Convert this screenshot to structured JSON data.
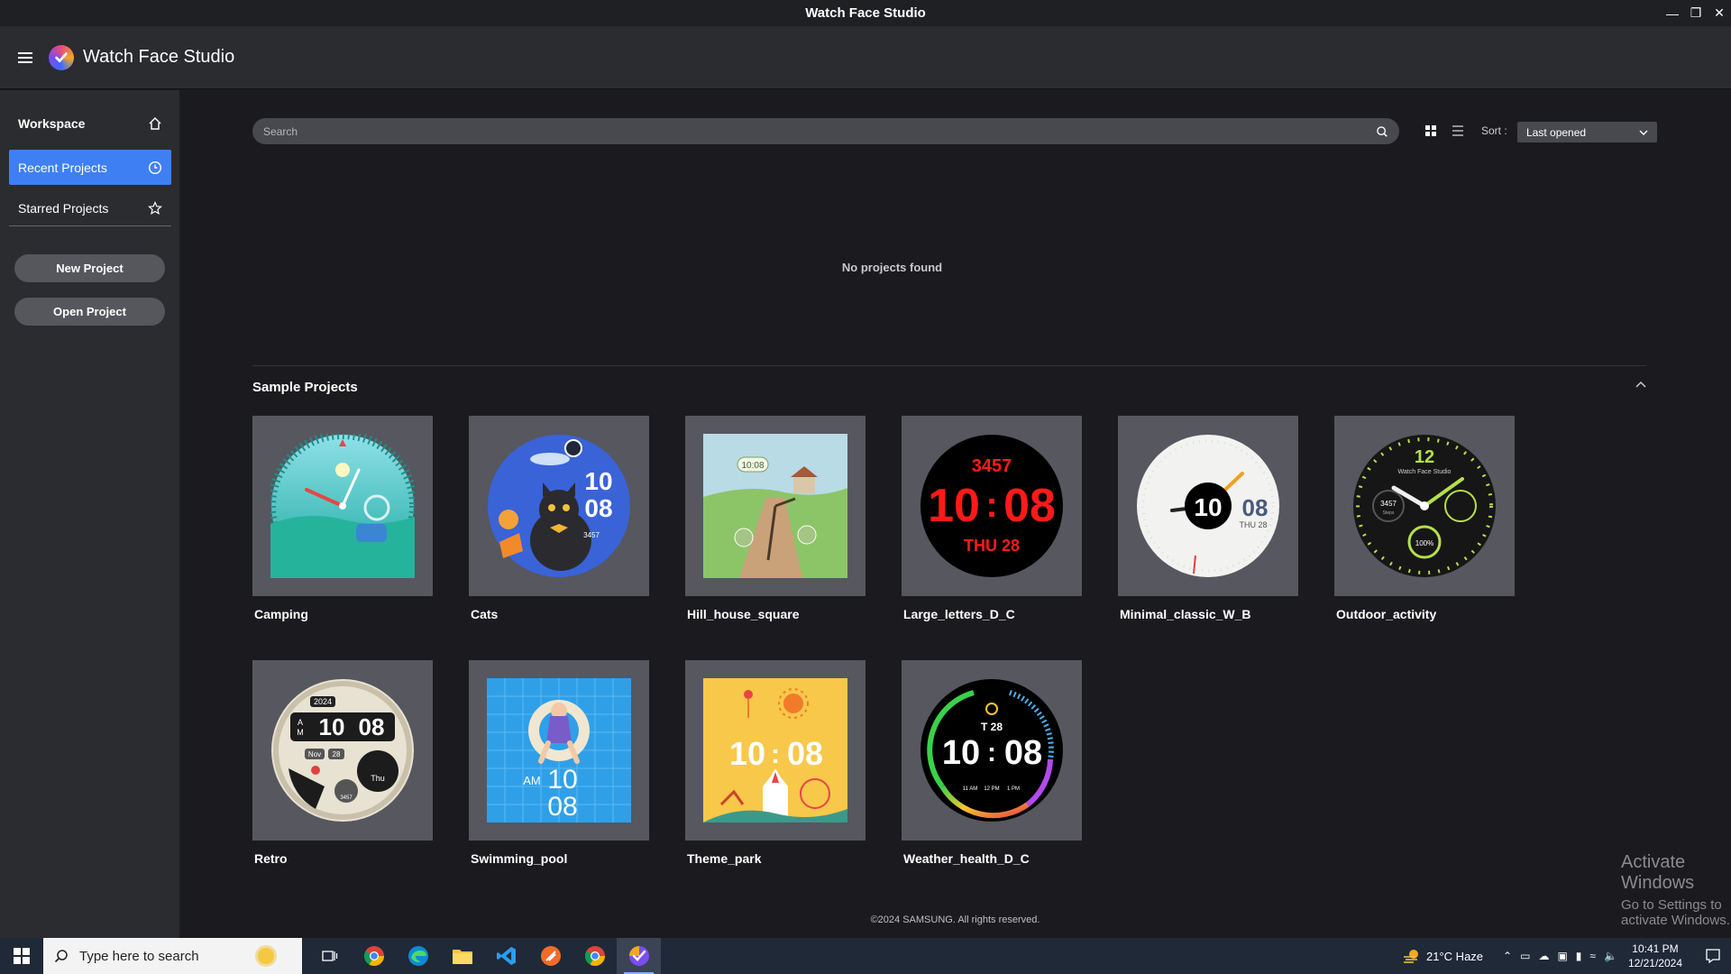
{
  "window": {
    "title": "Watch Face Studio",
    "controls": [
      "minimize-icon",
      "maximize-icon",
      "close-icon"
    ]
  },
  "header": {
    "app_name": "Watch Face Studio"
  },
  "sidebar": {
    "workspace_label": "Workspace",
    "items": [
      {
        "label": "Recent Projects",
        "icon": "clock-icon",
        "selected": true
      },
      {
        "label": "Starred Projects",
        "icon": "star-icon",
        "selected": false
      }
    ],
    "new_project_label": "New Project",
    "open_project_label": "Open Project"
  },
  "main": {
    "search_placeholder": "Search",
    "sort_label": "Sort :",
    "sort_value": "Last opened",
    "empty_message": "No projects found",
    "samples_title": "Sample Projects",
    "samples": [
      {
        "name": "Camping",
        "face": "camping"
      },
      {
        "name": "Cats",
        "face": "cats"
      },
      {
        "name": "Hill_house_square",
        "face": "hill"
      },
      {
        "name": "Large_letters_D_C",
        "face": "large"
      },
      {
        "name": "Minimal_classic_W_B",
        "face": "minimal"
      },
      {
        "name": "Outdoor_activity",
        "face": "outdoor"
      },
      {
        "name": "Retro",
        "face": "retro"
      },
      {
        "name": "Swimming_pool",
        "face": "pool"
      },
      {
        "name": "Theme_park",
        "face": "park"
      },
      {
        "name": "Weather_health_D_C",
        "face": "weather"
      }
    ],
    "copyright": "©2024 SAMSUNG. All rights reserved."
  },
  "faces": {
    "cats_hour": "10",
    "cats_min": "08",
    "cats_steps": "3457",
    "hill_time": "10:08",
    "large_steps": "3457",
    "large_hour": "10",
    "large_min": "08",
    "large_date": "THU 28",
    "minimal_hour": "10",
    "minimal_min": "08",
    "minimal_day": "THU 28",
    "outdoor_12": "12",
    "outdoor_brand": "Watch Face Studio",
    "outdoor_steps": "3457",
    "outdoor_steps_unit": "Steps",
    "outdoor_battery": "100%",
    "retro_year": "2024",
    "retro_ampm_a": "A",
    "retro_ampm_m": "M",
    "retro_hour": "10",
    "retro_min": "08",
    "retro_month": "Nov",
    "retro_date": "28",
    "retro_day": "Thu",
    "retro_steps": "3457",
    "pool_ampm": "AM",
    "pool_hour": "10",
    "pool_min": "08",
    "park_hour": "10",
    "park_min": "08",
    "weather_date": "T 28",
    "weather_hour": "10",
    "weather_min": "08",
    "weather_f1": "11 AM",
    "weather_f2": "12 PM",
    "weather_f3": "1 PM"
  },
  "watermark": {
    "line1": "Activate Windows",
    "line2": "Go to Settings to activate Windows."
  },
  "taskbar": {
    "search_placeholder": "Type here to search",
    "apps": [
      "task-view-icon",
      "chrome-icon",
      "edge-icon",
      "file-explorer-icon",
      "vscode-icon",
      "app-orange-icon",
      "chrome-icon",
      "watch-face-studio-icon"
    ],
    "weather": "21°C  Haze",
    "time": "10:41 PM",
    "date": "12/21/2024"
  },
  "colors": {
    "accent": "#3e80f3",
    "sidebar_bg": "#2b2c30",
    "main_bg": "#1b1b1f",
    "thumb_bg": "#56575f"
  }
}
